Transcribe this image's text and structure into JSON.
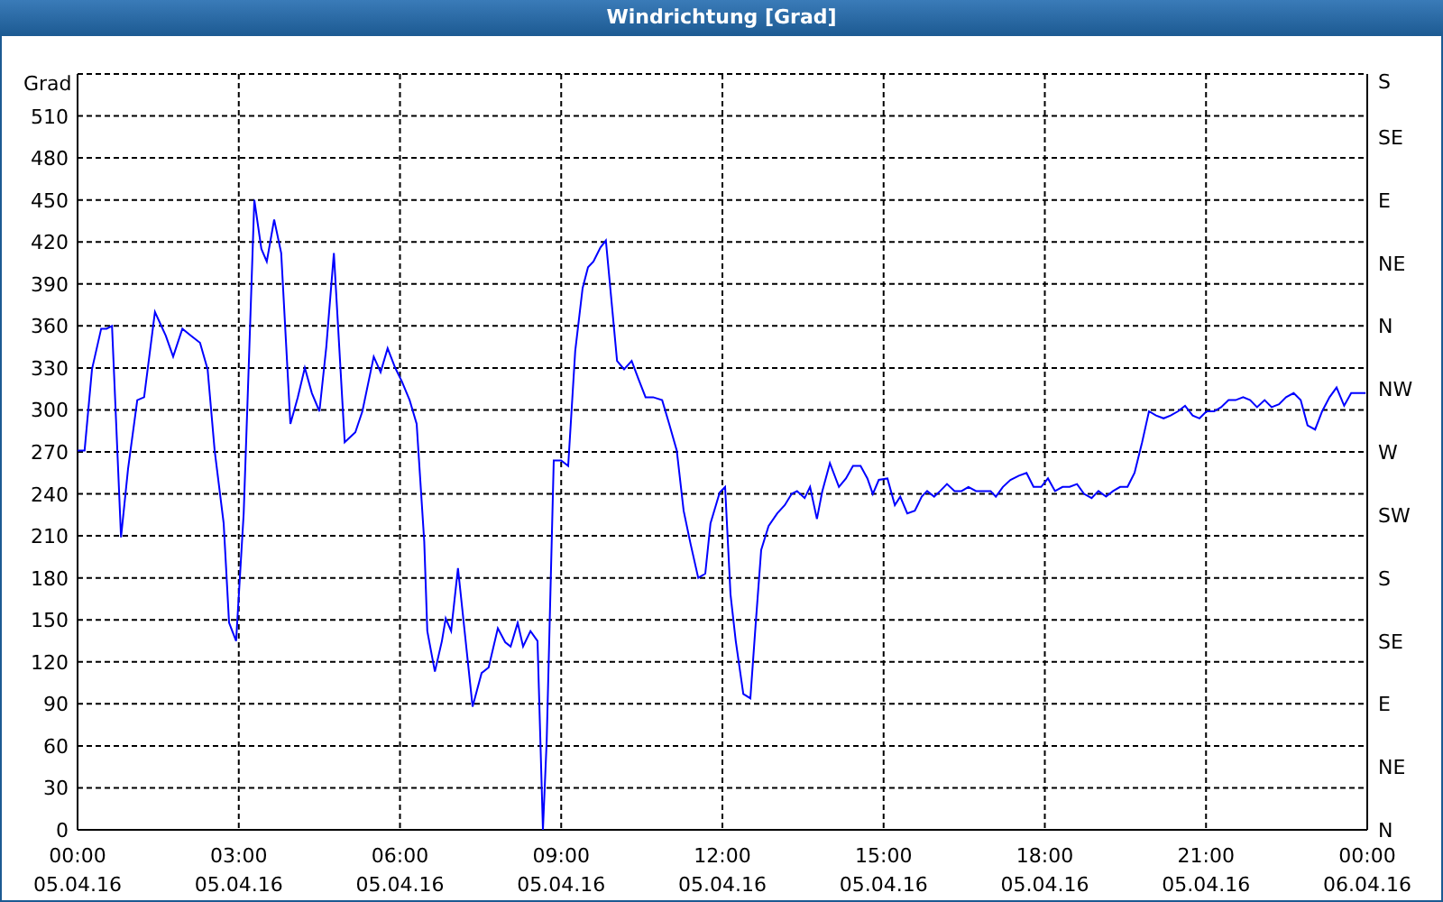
{
  "window": {
    "title": "Windrichtung [Grad]"
  },
  "chart": {
    "right_ticks": [
      "S",
      "SE",
      "E",
      "NE",
      "N",
      "NW",
      "W",
      "SW",
      "S",
      "SE",
      "E",
      "NE",
      "N"
    ],
    "x_tick_dates": [
      "05.04.16",
      "05.04.16",
      "05.04.16",
      "05.04.16",
      "05.04.16",
      "05.04.16",
      "05.04.16",
      "05.04.16",
      "06.04.16"
    ],
    "chart_data": {
      "type": "line",
      "grid": true,
      "ylabel": "Grad",
      "xlim": [
        0,
        24
      ],
      "ylim": [
        0,
        540
      ],
      "xticks": [
        {
          "value": 0,
          "label": "00:00"
        },
        {
          "value": 3,
          "label": "03:00"
        },
        {
          "value": 6,
          "label": "06:00"
        },
        {
          "value": 9,
          "label": "09:00"
        },
        {
          "value": 12,
          "label": "12:00"
        },
        {
          "value": 15,
          "label": "15:00"
        },
        {
          "value": 18,
          "label": "18:00"
        },
        {
          "value": 21,
          "label": "21:00"
        },
        {
          "value": 24,
          "label": "00:00"
        }
      ],
      "yticks": [
        0,
        30,
        60,
        90,
        120,
        150,
        180,
        210,
        240,
        270,
        300,
        330,
        360,
        390,
        420,
        450,
        480,
        510
      ],
      "x": [
        0,
        0.13,
        0.27,
        0.44,
        0.54,
        0.64,
        0.81,
        0.94,
        1.11,
        1.24,
        1.44,
        1.64,
        1.78,
        1.95,
        2.11,
        2.28,
        2.42,
        2.55,
        2.72,
        2.82,
        2.95,
        3.09,
        3.19,
        3.29,
        3.42,
        3.52,
        3.66,
        3.79,
        3.96,
        4.1,
        4.23,
        4.36,
        4.5,
        4.63,
        4.77,
        4.97,
        5.17,
        5.3,
        5.51,
        5.64,
        5.77,
        5.91,
        6.04,
        6.18,
        6.31,
        6.45,
        6.51,
        6.65,
        6.78,
        6.85,
        6.95,
        7.08,
        7.35,
        7.52,
        7.65,
        7.82,
        7.96,
        8.06,
        8.19,
        8.29,
        8.43,
        8.56,
        8.66,
        8.73,
        8.86,
        9,
        9.13,
        9.26,
        9.4,
        9.5,
        9.6,
        9.73,
        9.83,
        10.04,
        10.17,
        10.31,
        10.44,
        10.57,
        10.71,
        10.88,
        11.01,
        11.15,
        11.28,
        11.41,
        11.55,
        11.68,
        11.78,
        11.95,
        12.05,
        12.15,
        12.25,
        12.39,
        12.52,
        12.62,
        12.72,
        12.86,
        13.02,
        13.16,
        13.29,
        13.39,
        13.53,
        13.63,
        13.76,
        13.86,
        14,
        14.17,
        14.3,
        14.43,
        14.57,
        14.7,
        14.8,
        14.91,
        15.07,
        15.21,
        15.31,
        15.44,
        15.58,
        15.71,
        15.81,
        15.94,
        16.05,
        16.18,
        16.32,
        16.45,
        16.58,
        16.72,
        16.85,
        16.99,
        17.09,
        17.22,
        17.36,
        17.52,
        17.66,
        17.79,
        17.93,
        18.06,
        18.19,
        18.33,
        18.46,
        18.6,
        18.73,
        18.87,
        19,
        19.14,
        19.27,
        19.4,
        19.54,
        19.67,
        19.81,
        19.94,
        20.07,
        20.21,
        20.34,
        20.48,
        20.61,
        20.75,
        20.88,
        21.01,
        21.15,
        21.28,
        21.42,
        21.55,
        21.69,
        21.82,
        21.95,
        22.09,
        22.22,
        22.36,
        22.49,
        22.63,
        22.76,
        22.89,
        23.03,
        23.16,
        23.3,
        23.43,
        23.57,
        23.7,
        23.84,
        23.97
      ],
      "series": [
        {
          "color": "#0000ff",
          "values": [
            271,
            271,
            329,
            358,
            358,
            360,
            209,
            258,
            307,
            309,
            370,
            353,
            338,
            358,
            353,
            348,
            329,
            271,
            219,
            148,
            135,
            226,
            335,
            450,
            415,
            406,
            436,
            412,
            290,
            309,
            330,
            312,
            299,
            345,
            412,
            277,
            284,
            299,
            338,
            327,
            344,
            330,
            320,
            307,
            290,
            206,
            142,
            113,
            135,
            151,
            142,
            187,
            88,
            112,
            116,
            144,
            134,
            131,
            148,
            131,
            142,
            135,
            0,
            64,
            264,
            264,
            260,
            342,
            387,
            402,
            406,
            416,
            421,
            335,
            329,
            335,
            322,
            309,
            309,
            307,
            290,
            271,
            228,
            204,
            180,
            183,
            219,
            241,
            245,
            168,
            135,
            97,
            94,
            148,
            200,
            217,
            226,
            232,
            240,
            242,
            237,
            245,
            222,
            242,
            262,
            245,
            251,
            260,
            260,
            251,
            240,
            250,
            251,
            232,
            238,
            226,
            228,
            238,
            242,
            238,
            242,
            247,
            242,
            242,
            245,
            242,
            242,
            242,
            238,
            245,
            250,
            253,
            255,
            245,
            245,
            251,
            242,
            245,
            245,
            247,
            240,
            237,
            242,
            238,
            242,
            245,
            245,
            255,
            277,
            299,
            296,
            294,
            296,
            299,
            303,
            296,
            294,
            299,
            299,
            302,
            307,
            307,
            309,
            307,
            302,
            307,
            302,
            304,
            309,
            312,
            307,
            289,
            286,
            299,
            309,
            316,
            303,
            312,
            312,
            312
          ]
        }
      ]
    }
  }
}
